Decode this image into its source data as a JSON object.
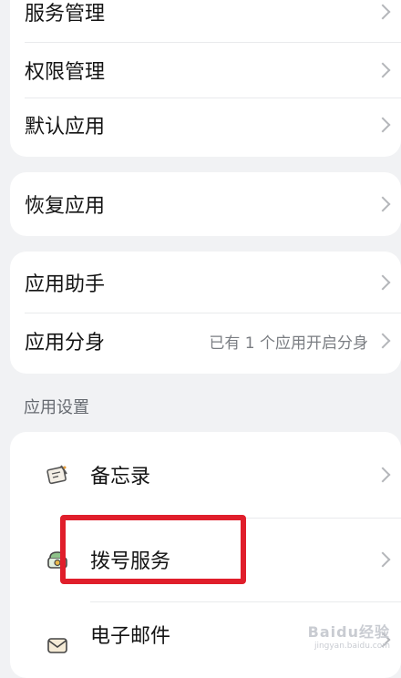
{
  "card1": {
    "items": [
      {
        "label": "服务管理"
      },
      {
        "label": "权限管理"
      },
      {
        "label": "默认应用"
      }
    ]
  },
  "card2": {
    "items": [
      {
        "label": "恢复应用"
      }
    ]
  },
  "card3": {
    "items": [
      {
        "label": "应用助手"
      },
      {
        "label": "应用分身",
        "value": "已有 1 个应用开启分身"
      }
    ]
  },
  "app_settings": {
    "title": "应用设置",
    "items": [
      {
        "label": "备忘录",
        "icon": "memo-icon"
      },
      {
        "label": "拨号服务",
        "icon": "phone-dial-icon"
      },
      {
        "label": "电子邮件",
        "icon": "email-icon"
      }
    ]
  },
  "watermark": {
    "text": "Baidu经验",
    "sub": "jingyan.baidu.com"
  },
  "colors": {
    "highlight": "#e01e2b",
    "background": "#f1f2f4"
  }
}
